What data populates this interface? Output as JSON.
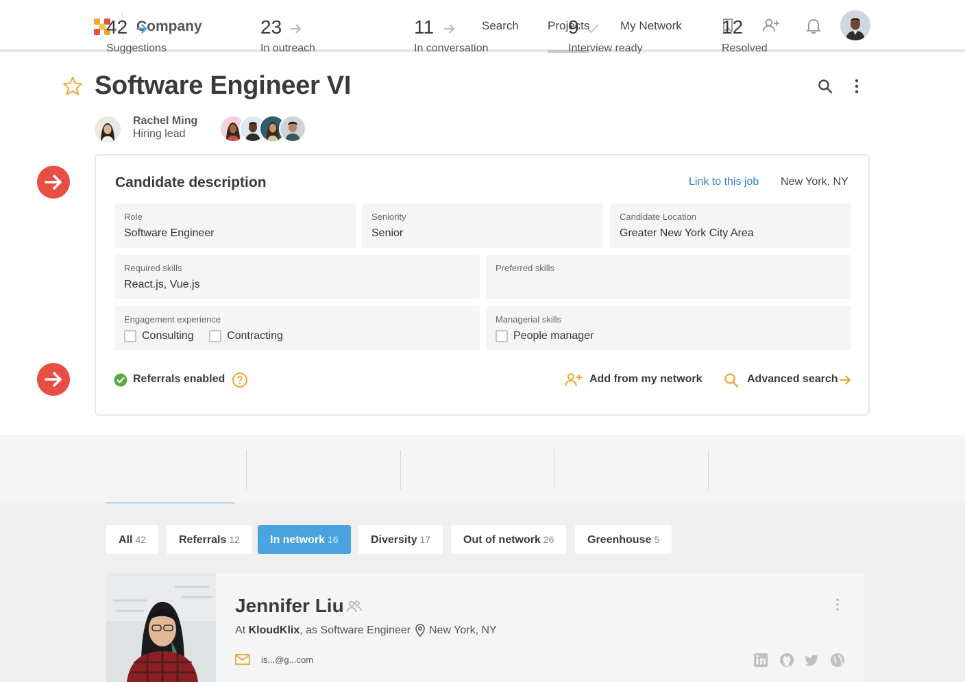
{
  "topbar": {
    "company": "Company",
    "nav": [
      "Search",
      "Projects",
      "My Network"
    ],
    "active_nav": "Projects",
    "icons": [
      "bookmark-icon",
      "add-person-icon",
      "bell-icon"
    ]
  },
  "header": {
    "title": "Software Engineer VI",
    "lead_name": "Rachel Ming",
    "lead_role": "Hiring lead"
  },
  "card": {
    "title": "Candidate description",
    "link": "Link to this job",
    "location": "New York, NY",
    "role_label": "Role",
    "role_value": "Software Engineer",
    "seniority_label": "Seniority",
    "seniority_value": "Senior",
    "cand_loc_label": "Candidate Location",
    "cand_loc_value": "Greater New York City Area",
    "req_label": "Required skills",
    "req_value": "React.js, Vue.js",
    "pref_label": "Preferred skills",
    "pref_value": "",
    "eng_label": "Engagement experience",
    "eng_opt1": "Consulting",
    "eng_opt2": "Contracting",
    "mgr_label": "Managerial skills",
    "mgr_opt1": "People manager",
    "referrals": "Referrals enabled",
    "add_network": "Add from my network",
    "advanced": "Advanced search"
  },
  "stats": [
    {
      "num": "42",
      "label": "Suggestions"
    },
    {
      "num": "23",
      "label": "In outreach"
    },
    {
      "num": "11",
      "label": "In conversation"
    },
    {
      "num": "9",
      "label": "Interview ready"
    },
    {
      "num": "12",
      "label": "Resolved"
    }
  ],
  "filters": [
    {
      "label": "All",
      "count": "42"
    },
    {
      "label": "Referrals",
      "count": "12"
    },
    {
      "label": "In network",
      "count": "16"
    },
    {
      "label": "Diversity",
      "count": "17"
    },
    {
      "label": "Out of network",
      "count": "26"
    },
    {
      "label": "Greenhouse",
      "count": "5"
    }
  ],
  "active_filter": "In network",
  "candidate": {
    "name": "Jennifer Liu",
    "at": "At",
    "company": "KloudKlix",
    "as": ", as Software Engineer",
    "city": "New York, NY",
    "email": "is...@g...com"
  },
  "colors": {
    "accent_blue": "#4aa3df",
    "link_blue": "#2f7fc4",
    "orange": "#f0a531",
    "red_marker": "#e94e43",
    "green_check": "#5aa845"
  }
}
